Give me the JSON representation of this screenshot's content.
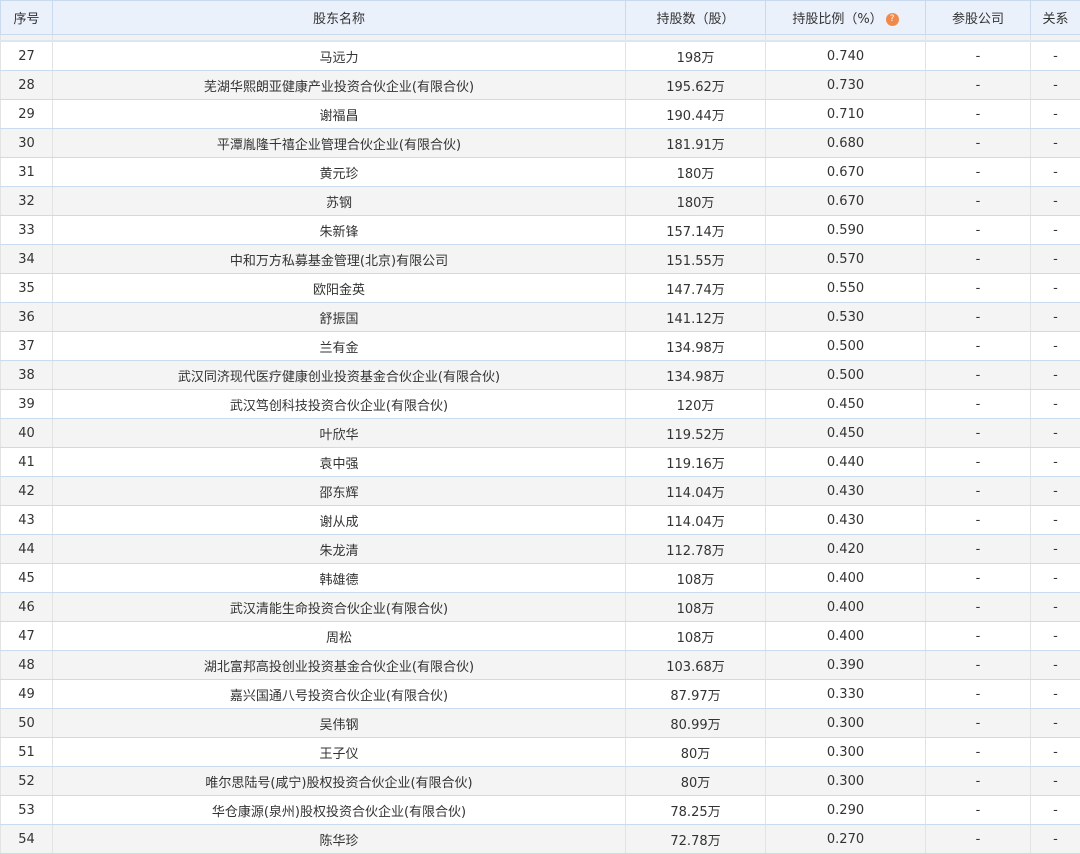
{
  "headers": {
    "index": "序号",
    "name": "股东名称",
    "shares": "持股数（股）",
    "ratio": "持股比例（%）",
    "companies": "参股公司",
    "relation": "关系"
  },
  "rows": [
    {
      "index": "27",
      "name": "马远力",
      "shares": "198万",
      "ratio": "0.740",
      "companies": "-",
      "relation": "-"
    },
    {
      "index": "28",
      "name": "芜湖华熙朗亚健康产业投资合伙企业(有限合伙)",
      "shares": "195.62万",
      "ratio": "0.730",
      "companies": "-",
      "relation": "-"
    },
    {
      "index": "29",
      "name": "谢福昌",
      "shares": "190.44万",
      "ratio": "0.710",
      "companies": "-",
      "relation": "-"
    },
    {
      "index": "30",
      "name": "平潭胤隆千禧企业管理合伙企业(有限合伙)",
      "shares": "181.91万",
      "ratio": "0.680",
      "companies": "-",
      "relation": "-"
    },
    {
      "index": "31",
      "name": "黄元珍",
      "shares": "180万",
      "ratio": "0.670",
      "companies": "-",
      "relation": "-"
    },
    {
      "index": "32",
      "name": "苏钢",
      "shares": "180万",
      "ratio": "0.670",
      "companies": "-",
      "relation": "-"
    },
    {
      "index": "33",
      "name": "朱新锋",
      "shares": "157.14万",
      "ratio": "0.590",
      "companies": "-",
      "relation": "-"
    },
    {
      "index": "34",
      "name": "中和万方私募基金管理(北京)有限公司",
      "shares": "151.55万",
      "ratio": "0.570",
      "companies": "-",
      "relation": "-"
    },
    {
      "index": "35",
      "name": "欧阳金英",
      "shares": "147.74万",
      "ratio": "0.550",
      "companies": "-",
      "relation": "-"
    },
    {
      "index": "36",
      "name": "舒振国",
      "shares": "141.12万",
      "ratio": "0.530",
      "companies": "-",
      "relation": "-"
    },
    {
      "index": "37",
      "name": "兰有金",
      "shares": "134.98万",
      "ratio": "0.500",
      "companies": "-",
      "relation": "-"
    },
    {
      "index": "38",
      "name": "武汉同济现代医疗健康创业投资基金合伙企业(有限合伙)",
      "shares": "134.98万",
      "ratio": "0.500",
      "companies": "-",
      "relation": "-"
    },
    {
      "index": "39",
      "name": "武汉笃创科技投资合伙企业(有限合伙)",
      "shares": "120万",
      "ratio": "0.450",
      "companies": "-",
      "relation": "-"
    },
    {
      "index": "40",
      "name": "叶欣华",
      "shares": "119.52万",
      "ratio": "0.450",
      "companies": "-",
      "relation": "-"
    },
    {
      "index": "41",
      "name": "袁中强",
      "shares": "119.16万",
      "ratio": "0.440",
      "companies": "-",
      "relation": "-"
    },
    {
      "index": "42",
      "name": "邵东辉",
      "shares": "114.04万",
      "ratio": "0.430",
      "companies": "-",
      "relation": "-"
    },
    {
      "index": "43",
      "name": "谢从成",
      "shares": "114.04万",
      "ratio": "0.430",
      "companies": "-",
      "relation": "-"
    },
    {
      "index": "44",
      "name": "朱龙清",
      "shares": "112.78万",
      "ratio": "0.420",
      "companies": "-",
      "relation": "-"
    },
    {
      "index": "45",
      "name": "韩雄德",
      "shares": "108万",
      "ratio": "0.400",
      "companies": "-",
      "relation": "-"
    },
    {
      "index": "46",
      "name": "武汉清能生命投资合伙企业(有限合伙)",
      "shares": "108万",
      "ratio": "0.400",
      "companies": "-",
      "relation": "-"
    },
    {
      "index": "47",
      "name": "周松",
      "shares": "108万",
      "ratio": "0.400",
      "companies": "-",
      "relation": "-"
    },
    {
      "index": "48",
      "name": "湖北富邦高投创业投资基金合伙企业(有限合伙)",
      "shares": "103.68万",
      "ratio": "0.390",
      "companies": "-",
      "relation": "-"
    },
    {
      "index": "49",
      "name": "嘉兴国通八号投资合伙企业(有限合伙)",
      "shares": "87.97万",
      "ratio": "0.330",
      "companies": "-",
      "relation": "-"
    },
    {
      "index": "50",
      "name": "吴伟钢",
      "shares": "80.99万",
      "ratio": "0.300",
      "companies": "-",
      "relation": "-"
    },
    {
      "index": "51",
      "name": "王子仪",
      "shares": "80万",
      "ratio": "0.300",
      "companies": "-",
      "relation": "-"
    },
    {
      "index": "52",
      "name": "唯尔思陆号(咸宁)股权投资合伙企业(有限合伙)",
      "shares": "80万",
      "ratio": "0.300",
      "companies": "-",
      "relation": "-"
    },
    {
      "index": "53",
      "name": "华仓康源(泉州)股权投资合伙企业(有限合伙)",
      "shares": "78.25万",
      "ratio": "0.290",
      "companies": "-",
      "relation": "-"
    },
    {
      "index": "54",
      "name": "陈华珍",
      "shares": "72.78万",
      "ratio": "0.270",
      "companies": "-",
      "relation": "-"
    }
  ],
  "help_icon": "?",
  "colors": {
    "header_bg": "#eaf1fb",
    "row_alt": "#f4f4f4",
    "help": "#f08a4b"
  }
}
